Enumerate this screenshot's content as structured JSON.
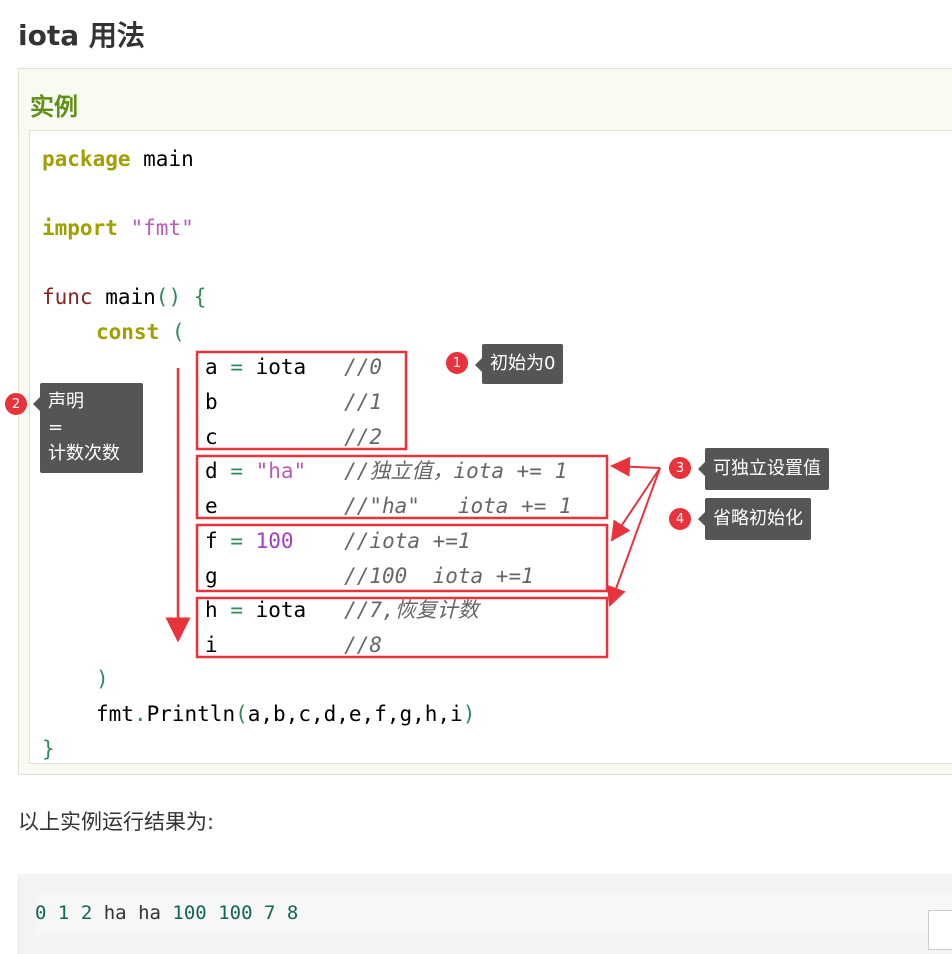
{
  "page": {
    "title": "iota 用法"
  },
  "example": {
    "label": "实例"
  },
  "code": {
    "l1": {
      "kw": "package",
      "rest": " main"
    },
    "l2": {
      "kw": "import",
      "str": "\"fmt\""
    },
    "l3": {
      "kw": "func",
      "name": " main",
      "parens": "()",
      "brace": "{"
    },
    "l4": {
      "kw": "const",
      "paren": "("
    },
    "a": {
      "name": "a",
      "op": "=",
      "val": "iota",
      "cmt": "//0"
    },
    "b": {
      "name": "b",
      "cmt": "//1"
    },
    "c": {
      "name": "c",
      "cmt": "//2"
    },
    "d": {
      "name": "d",
      "op": "=",
      "val": "\"ha\"",
      "cmt": "//独立值，iota += 1"
    },
    "e": {
      "name": "e",
      "cmt": "//\"ha\"   iota += 1"
    },
    "f": {
      "name": "f",
      "op": "=",
      "val": "100",
      "cmt": "//iota +=1"
    },
    "g": {
      "name": "g",
      "cmt": "//100  iota +=1"
    },
    "h": {
      "name": "h",
      "op": "=",
      "val": "iota",
      "cmt": "//7,恢复计数"
    },
    "i": {
      "name": "i",
      "cmt": "//8"
    },
    "close_paren": ")",
    "println": {
      "pkg": "fmt",
      "dot": ".",
      "fn": "Println",
      "open": "(",
      "args": "a,b,c,d,e,f,g,h,i",
      "close": ")"
    },
    "close_brace": "}"
  },
  "annotations": [
    {
      "num": "1",
      "text": "初始为0"
    },
    {
      "num": "2",
      "text": "声明\n=\n计数次数"
    },
    {
      "num": "3",
      "text": "可独立设置值"
    },
    {
      "num": "4",
      "text": "省略初始化"
    }
  ],
  "result": {
    "label": "以上实例运行结果为:",
    "output": [
      "0",
      "1",
      "2",
      "ha",
      "ha",
      "100",
      "100",
      "7",
      "8"
    ]
  },
  "colors": {
    "annotation_red": "#e8323c",
    "tag_bg": "#555555",
    "example_green": "#5f8f15"
  }
}
